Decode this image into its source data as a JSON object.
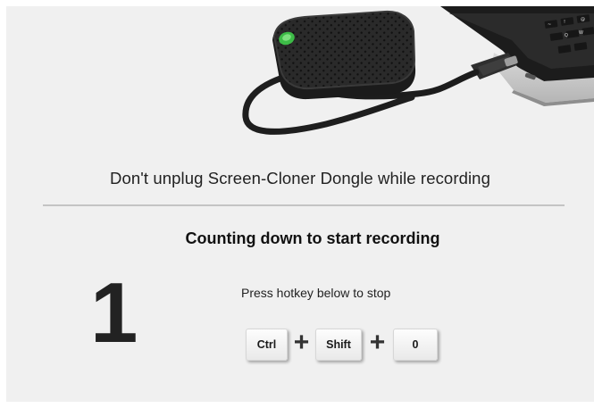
{
  "hero": {
    "image": "dongle-connected-to-laptop"
  },
  "warning": {
    "text": "Don't unplug Screen-Cloner Dongle while recording"
  },
  "countdown": {
    "title": "Counting down to start recording",
    "number": "1"
  },
  "stop_hint": {
    "text": "Press hotkey below to stop"
  },
  "hotkey": {
    "keys": [
      "Ctrl",
      "Shift",
      "0"
    ],
    "separator": "+"
  },
  "colors": {
    "background": "#f0f0f0",
    "text": "#222222",
    "divider": "#c4c4c4",
    "dongle_led": "#3dbb47"
  }
}
